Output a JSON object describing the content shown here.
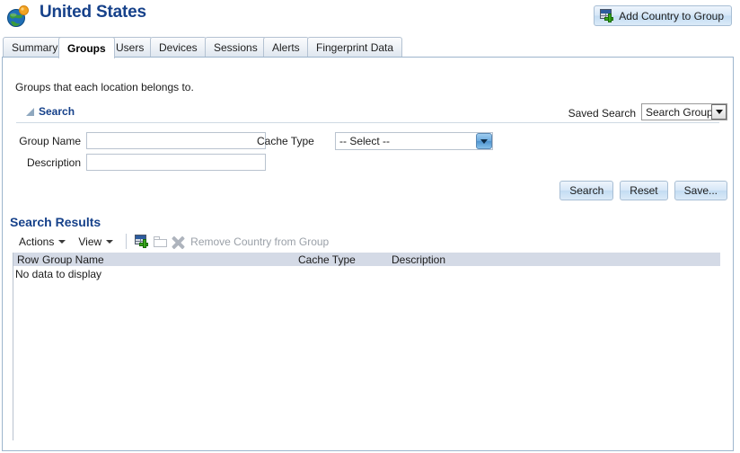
{
  "header": {
    "title": "United States",
    "globe_icon": "globe-icon",
    "add_button": {
      "label": "Add Country to Group",
      "icon": "add-window-plus-icon"
    }
  },
  "tabs": [
    {
      "label": "Summary",
      "selected": false
    },
    {
      "label": "Groups",
      "selected": true
    },
    {
      "label": "Users",
      "selected": false
    },
    {
      "label": "Devices",
      "selected": false
    },
    {
      "label": "Sessions",
      "selected": false
    },
    {
      "label": "Alerts",
      "selected": false
    },
    {
      "label": "Fingerprint Data",
      "selected": false
    }
  ],
  "content": {
    "intro_text": "Groups that each location belongs to."
  },
  "search": {
    "section_label": "Search",
    "collapse_icon": "triangle-collapse-icon",
    "saved_search_label": "Saved Search",
    "saved_search_value": "Search Groups",
    "saved_search_arrow_icon": "chevron-down-icon",
    "fields": {
      "group_name_label": "Group Name",
      "group_name_value": "",
      "group_name_placeholder": "",
      "description_label": "Description",
      "description_value": "",
      "description_placeholder": "",
      "cache_type_label": "Cache Type",
      "cache_type_value": "-- Select --",
      "cache_type_arrow_icon": "chevron-down-icon"
    },
    "buttons": {
      "search": "Search",
      "reset": "Reset",
      "save": "Save..."
    }
  },
  "results": {
    "title": "Search Results",
    "toolbar": {
      "actions_label": "Actions",
      "actions_caret_icon": "caret-down-icon",
      "view_label": "View",
      "view_caret_icon": "caret-down-icon",
      "add_icon": "add-window-plus-icon",
      "detach_icon": "folder-icon",
      "remove_icon": "remove-x-icon",
      "remove_label": "Remove Country from Group"
    },
    "columns": {
      "row": "Row",
      "group_name": "Group Name",
      "cache_type": "Cache Type",
      "description": "Description"
    },
    "empty_message": "No data to display",
    "rows": []
  },
  "colors": {
    "title_blue": "#16418a",
    "panel_border": "#9db5cd",
    "table_header": "#d4dae6",
    "button_blue": "#c3dcf2",
    "disabled_gray": "#9aa0a8"
  }
}
